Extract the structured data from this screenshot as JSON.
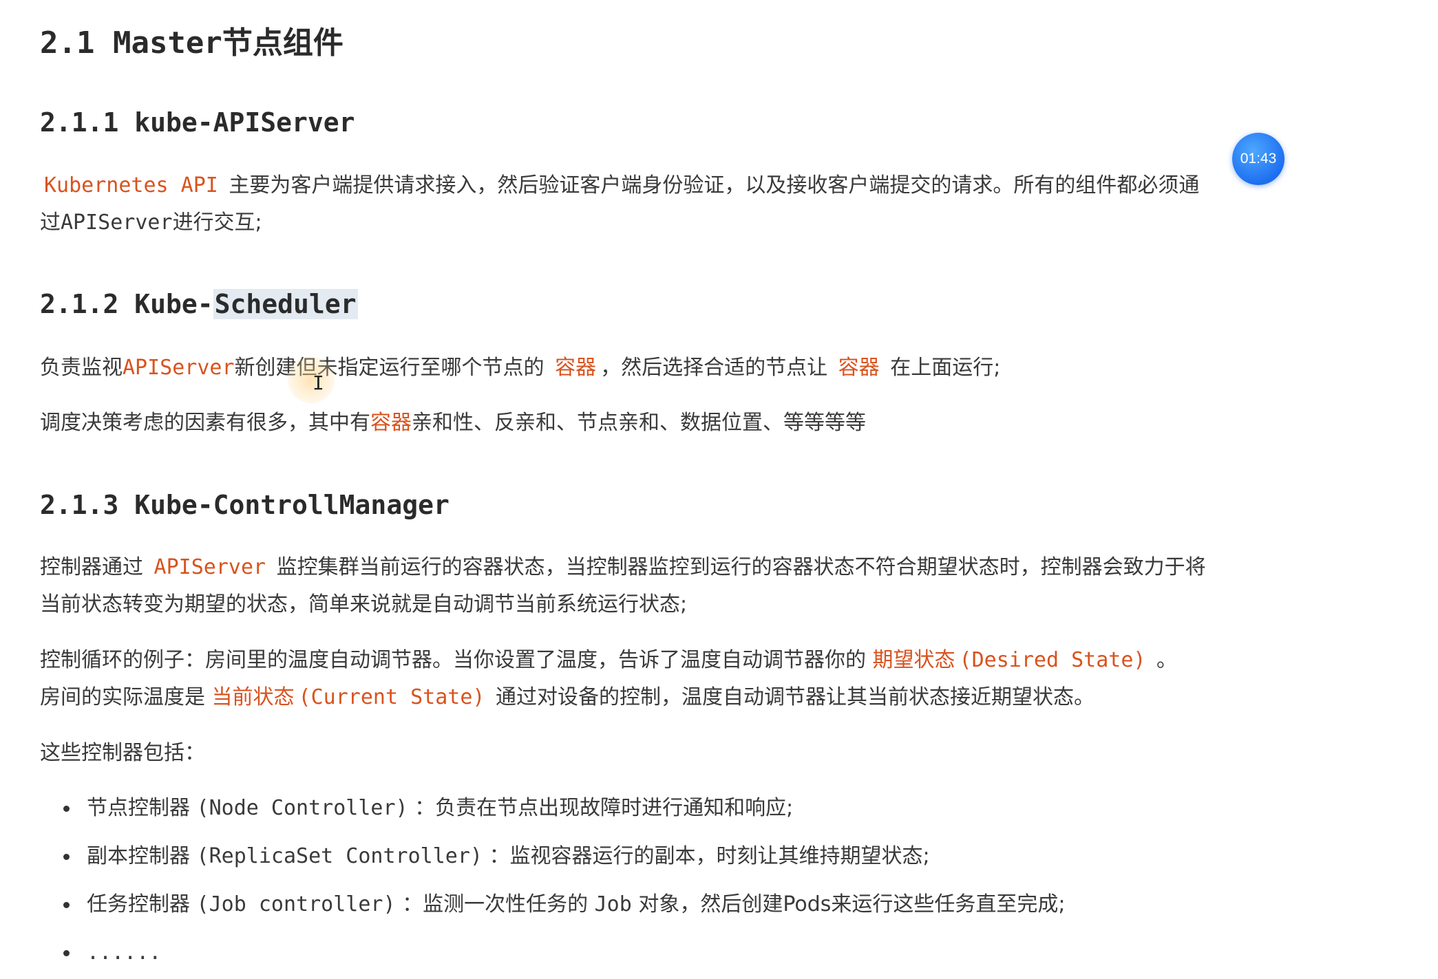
{
  "heading_main": "2.1 Master节点组件",
  "sections": {
    "apiserver": {
      "heading": "2.1.1 kube-APIServer",
      "line1": {
        "code": "Kubernetes API",
        "text": "主要为客户端提供请求接入，然后验证客户端身份验证，以及接收客户端提交的请求。所有的组件都必须通"
      },
      "line2": {
        "pre": "过",
        "code": "APIServer",
        "post": "进行交互;"
      }
    },
    "scheduler": {
      "heading_prefix": "2.1.2 Kube-",
      "heading_highlight": "Scheduler",
      "line1": {
        "pre": "负责监视",
        "code": "APIServer",
        "mid": "新创建但未指定运行至哪个节点的",
        "code2": "容器",
        "mid2": "，然后选择合适的节点让",
        "code3": "容器",
        "post": "在上面运行;"
      },
      "line2": {
        "pre": "调度决策考虑的因素有很多，其中有",
        "accent": "容器",
        "post": "亲和性、反亲和、节点亲和、数据位置、等等等等"
      }
    },
    "controller": {
      "heading": "2.1.3 Kube-ControllManager",
      "para1_line1": {
        "pre": "控制器通过",
        "code": "APIServer",
        "post": "监控集群当前运行的容器状态，当控制器监控到运行的容器状态不符合期望状态时，控制器会致力于将"
      },
      "para1_line2": "当前状态转变为期望的状态，简单来说就是自动调节当前系统运行状态;",
      "para2_line1": {
        "pre": "控制循环的例子：房间里的温度自动调节器。当你设置了温度，告诉了温度自动调节器你的",
        "accent": "期望状态",
        "code": "(Desired State)",
        "post": "。"
      },
      "para2_line2": {
        "pre": "房间的实际温度是",
        "accent": "当前状态",
        "code": "(Current State)",
        "post": "通过对设备的控制，温度自动调节器让其当前状态接近期望状态。"
      },
      "para3": "这些控制器包括：",
      "list": [
        {
          "zh": "节点控制器",
          "code": "(Node Controller)",
          "desc": "：负责在节点出现故障时进行通知和响应;"
        },
        {
          "zh": "副本控制器",
          "code": "(ReplicaSet Controller)",
          "desc": "：监视容器运行的副本，时刻让其维持期望状态;"
        },
        {
          "zh": "任务控制器",
          "code": "(Job controller)",
          "desc_pre": "：监测一次性任务的",
          "desc_code": "Job",
          "desc_post": "对象，然后创建Pods来运行这些任务直至完成;"
        },
        {
          "ellipsis": "......"
        }
      ]
    }
  },
  "timer": "01:43",
  "colors": {
    "accent": "#d9531e",
    "text": "#3a3a3a",
    "heading": "#2b2b2b",
    "highlight_bg": "#e4eaf1",
    "timer_bg": "#1e6ff0"
  }
}
